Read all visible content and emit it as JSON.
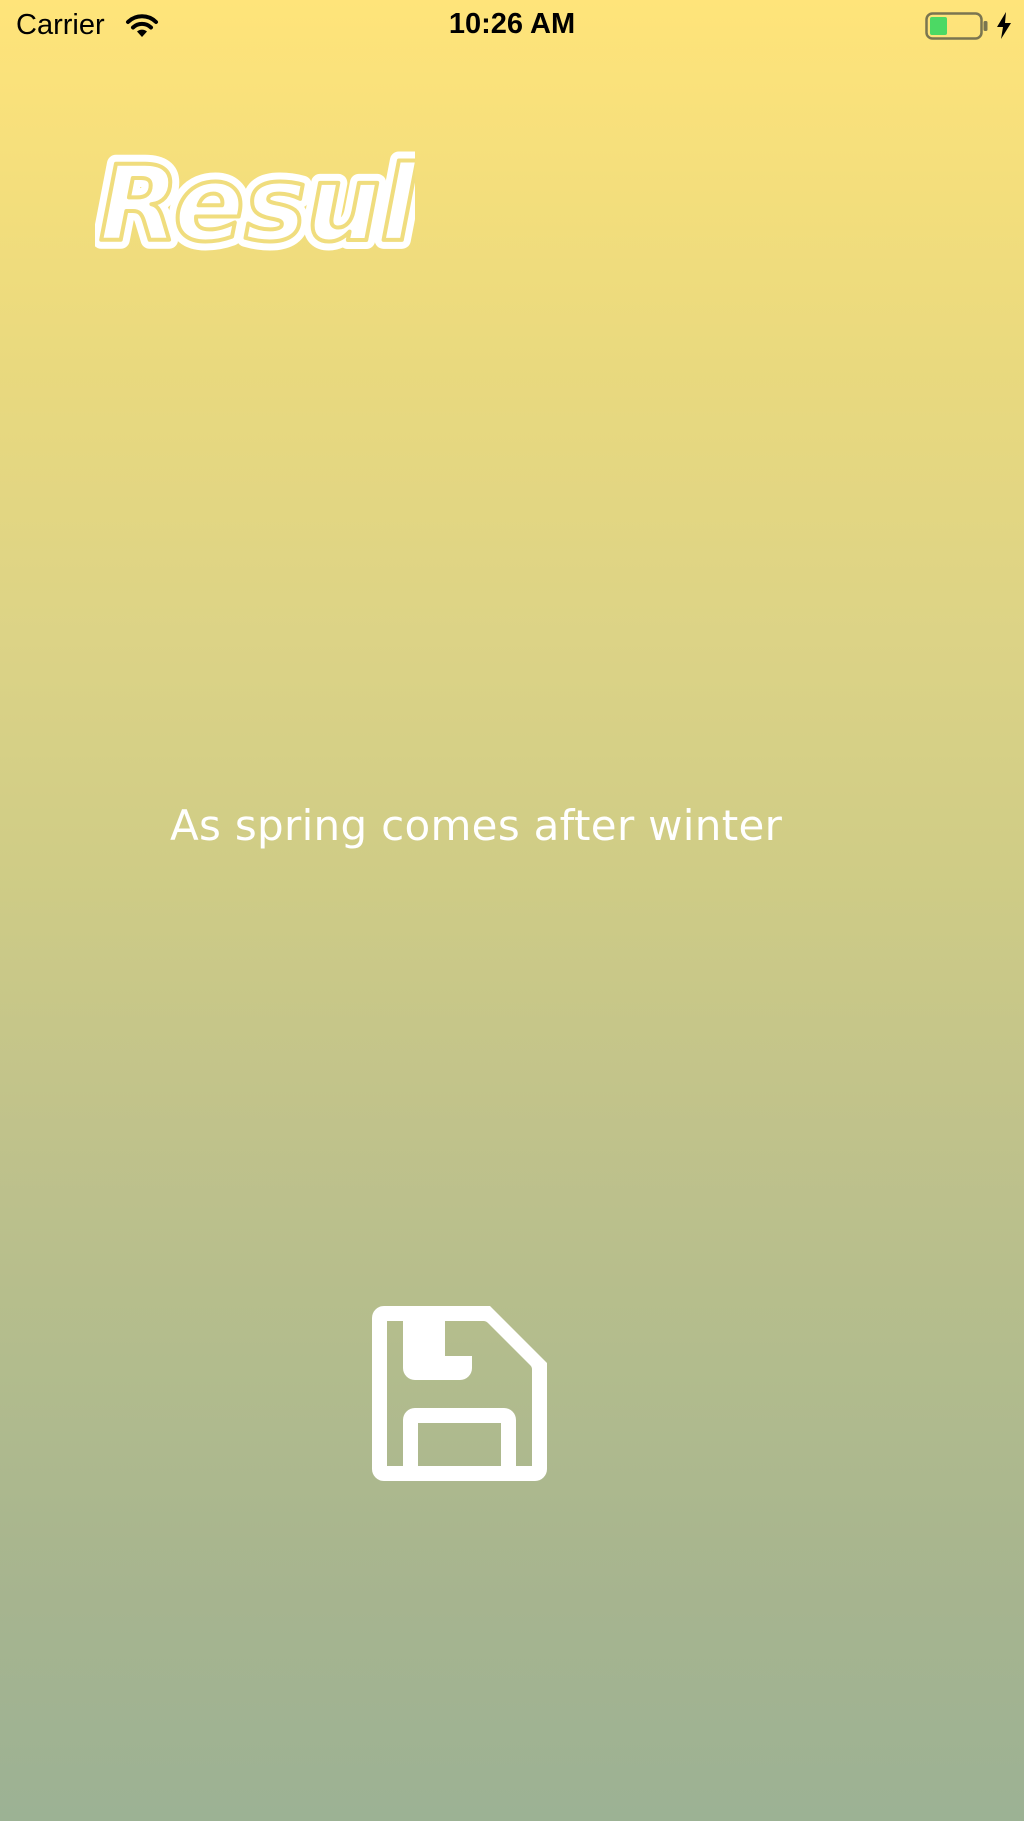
{
  "status_bar": {
    "carrier": "Carrier",
    "time": "10:26 AM",
    "battery_color": "#4cd964"
  },
  "title": {
    "text": "Result"
  },
  "main": {
    "quote": "As spring comes after winter"
  },
  "icons": {
    "wifi": "wifi-icon",
    "battery": "battery-icon",
    "charging": "charging-bolt-icon",
    "save": "floppy-disk-save-icon"
  },
  "colors": {
    "gradient_top": "#ffe47a",
    "gradient_bottom": "#9cb294",
    "text": "#ffffff"
  }
}
